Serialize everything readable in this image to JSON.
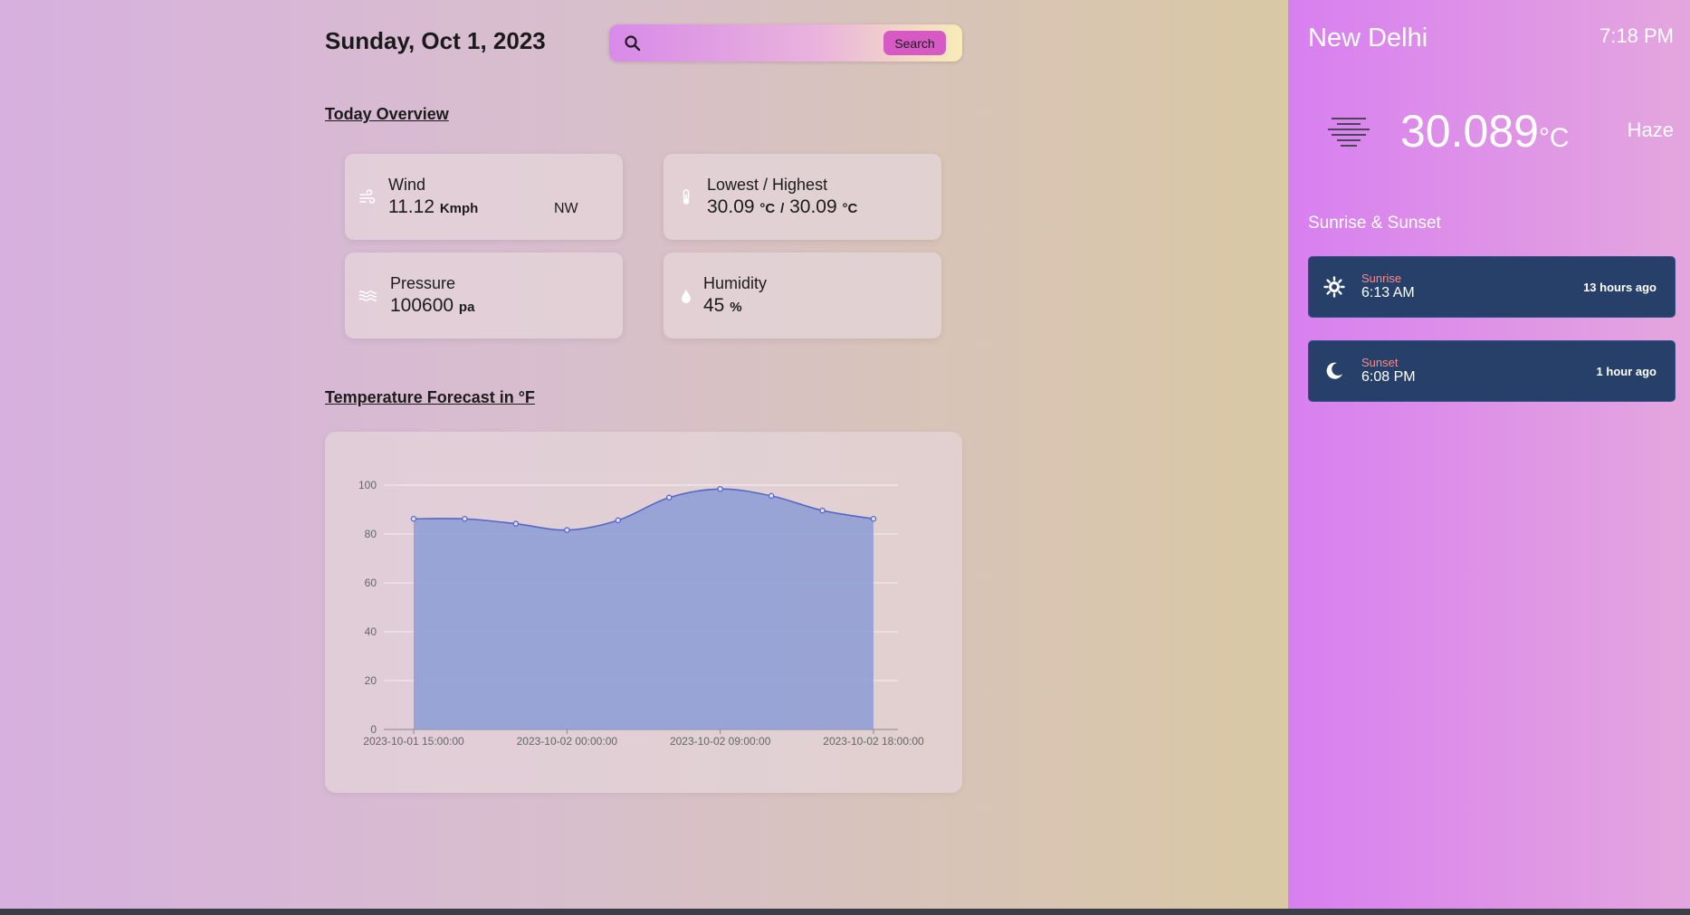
{
  "header": {
    "date": "Sunday, Oct 1, 2023"
  },
  "search": {
    "placeholder": "",
    "value": "",
    "button_label": "Search"
  },
  "overview": {
    "title": "Today Overview",
    "wind": {
      "label": "Wind",
      "value": "11.12",
      "unit": "Kmph",
      "direction": "NW",
      "icon": "wind-icon"
    },
    "lowhigh": {
      "label": "Lowest / Highest",
      "low": "30.09",
      "high": "30.09",
      "unit": "°C",
      "separator": "/",
      "icon": "thermometer-icon"
    },
    "pressure": {
      "label": "Pressure",
      "value": "100600",
      "unit": "pa",
      "icon": "pressure-icon"
    },
    "humidity": {
      "label": "Humidity",
      "value": "45",
      "unit": "%",
      "icon": "droplet-icon"
    }
  },
  "forecast": {
    "title": "Temperature Forecast in °F"
  },
  "chart_data": {
    "type": "area",
    "x": [
      "2023-10-01 15:00:00",
      "2023-10-01 18:00:00",
      "2023-10-01 21:00:00",
      "2023-10-02 00:00:00",
      "2023-10-02 03:00:00",
      "2023-10-02 06:00:00",
      "2023-10-02 09:00:00",
      "2023-10-02 12:00:00",
      "2023-10-02 15:00:00",
      "2023-10-02 18:00:00"
    ],
    "xticks": [
      "2023-10-01 15:00:00",
      "2023-10-02 00:00:00",
      "2023-10-02 09:00:00",
      "2023-10-02 18:00:00"
    ],
    "values": [
      86.2,
      86.2,
      84.2,
      81.6,
      85.6,
      94.9,
      98.4,
      95.6,
      89.6,
      86.2
    ],
    "yticks": [
      0,
      20,
      40,
      60,
      80,
      100
    ],
    "ylim": [
      0,
      100
    ],
    "grid": true,
    "colors": {
      "fill": "#8c9cd6",
      "line": "#5567c6"
    }
  },
  "sidebar": {
    "city": "New Delhi",
    "time": "7:18 PM",
    "temperature": "30.089",
    "temp_unit": "°C",
    "condition": "Haze",
    "condition_icon": "haze-icon",
    "sun_title": "Sunrise & Sunset",
    "sunrise": {
      "label": "Sunrise",
      "time": "6:13 AM",
      "ago": "13 hours ago",
      "icon": "sun-icon"
    },
    "sunset": {
      "label": "Sunset",
      "time": "6:08 PM",
      "ago": "1 hour ago",
      "icon": "moon-icon"
    }
  },
  "colors": {
    "accent": "#d659c4",
    "sun_card": "#27406a",
    "sun_label": "#ff8787"
  }
}
